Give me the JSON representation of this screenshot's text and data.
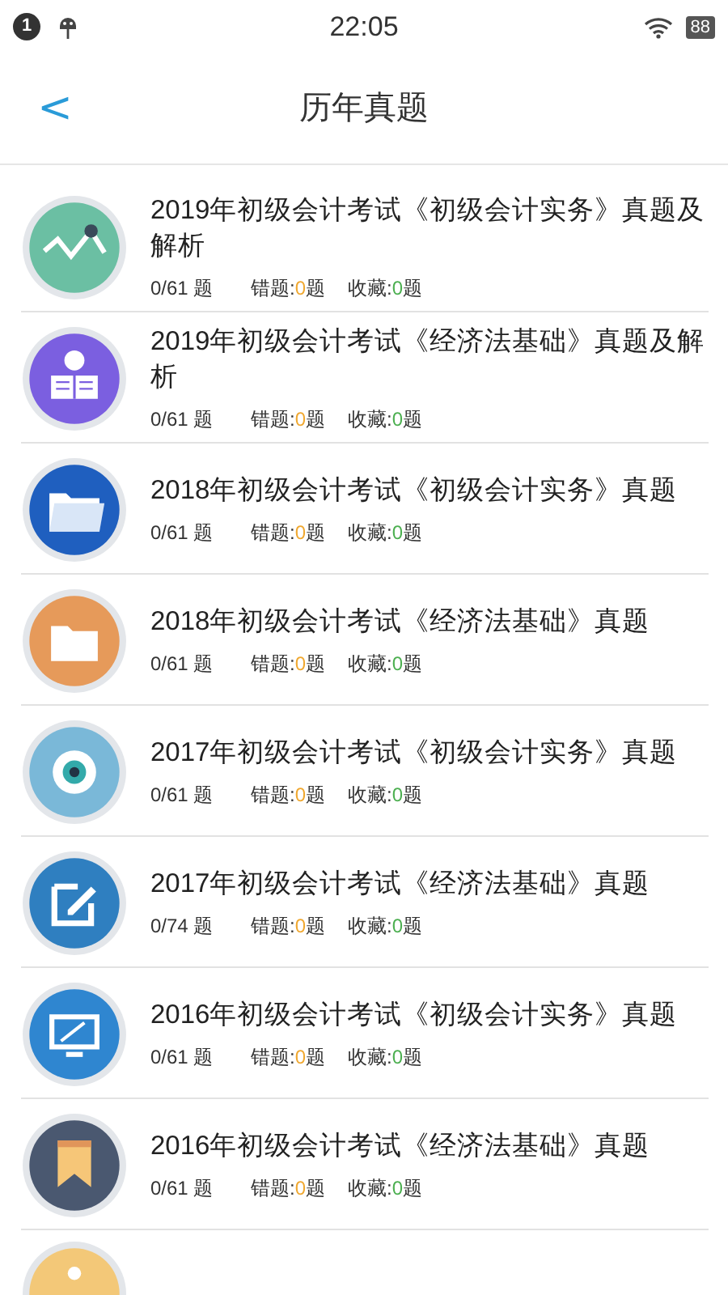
{
  "status_bar": {
    "notification_count": "1",
    "time": "22:05",
    "battery": "88"
  },
  "header": {
    "back": "<",
    "title": "历年真题"
  },
  "items": [
    {
      "kind": "chart",
      "color": "#6bbfa3",
      "title": "2019年初级会计考试《初级会计实务》真题及解析",
      "progress": "0/61 题",
      "wrong_label": "错题:",
      "wrong_count": "0",
      "wrong_unit": "题",
      "fav_label": "收藏:",
      "fav_count": "0",
      "fav_unit": "题"
    },
    {
      "kind": "reader",
      "color": "#7b5fe0",
      "title": "2019年初级会计考试《经济法基础》真题及解析",
      "progress": "0/61 题",
      "wrong_label": "错题:",
      "wrong_count": "0",
      "wrong_unit": "题",
      "fav_label": "收藏:",
      "fav_count": "0",
      "fav_unit": "题"
    },
    {
      "kind": "folder",
      "color": "#1f5fbf",
      "title": "2018年初级会计考试《初级会计实务》真题",
      "progress": "0/61 题",
      "wrong_label": "错题:",
      "wrong_count": "0",
      "wrong_unit": "题",
      "fav_label": "收藏:",
      "fav_count": "0",
      "fav_unit": "题"
    },
    {
      "kind": "plain",
      "color": "#e69a5a",
      "title": "2018年初级会计考试《经济法基础》真题",
      "progress": "0/61 题",
      "wrong_label": "错题:",
      "wrong_count": "0",
      "wrong_unit": "题",
      "fav_label": "收藏:",
      "fav_count": "0",
      "fav_unit": "题"
    },
    {
      "kind": "eye",
      "color": "#7ab8d8",
      "title": "2017年初级会计考试《初级会计实务》真题",
      "progress": "0/61 题",
      "wrong_label": "错题:",
      "wrong_count": "0",
      "wrong_unit": "题",
      "fav_label": "收藏:",
      "fav_count": "0",
      "fav_unit": "题"
    },
    {
      "kind": "edit",
      "color": "#2f7fc0",
      "title": "2017年初级会计考试《经济法基础》真题",
      "progress": "0/74 题",
      "wrong_label": "错题:",
      "wrong_count": "0",
      "wrong_unit": "题",
      "fav_label": "收藏:",
      "fav_count": "0",
      "fav_unit": "题"
    },
    {
      "kind": "monitor",
      "color": "#2f86d0",
      "title": "2016年初级会计考试《初级会计实务》真题",
      "progress": "0/61 题",
      "wrong_label": "错题:",
      "wrong_count": "0",
      "wrong_unit": "题",
      "fav_label": "收藏:",
      "fav_count": "0",
      "fav_unit": "题"
    },
    {
      "kind": "bookmark",
      "color": "#4a5870",
      "title": "2016年初级会计考试《经济法基础》真题",
      "progress": "0/61 题",
      "wrong_label": "错题:",
      "wrong_count": "0",
      "wrong_unit": "题",
      "fav_label": "收藏:",
      "fav_count": "0",
      "fav_unit": "题"
    },
    {
      "kind": "partial",
      "color": "#f3c878"
    }
  ]
}
